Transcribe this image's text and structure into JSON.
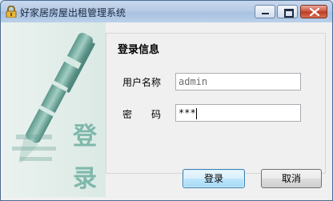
{
  "window": {
    "title": "好家居房屋出租管理系统",
    "app_icon": "lock-icon",
    "controls": {
      "minimize": "minimize-icon",
      "maximize": "maximize-icon",
      "close": "close-icon"
    }
  },
  "banner": {
    "logo_text": "登录",
    "image": "pen-illustration"
  },
  "form": {
    "group_title": "登录信息",
    "username_label": "用户名称",
    "username_value": "admin",
    "password_label": "密　　码",
    "password_value": "***"
  },
  "buttons": {
    "login": "登录",
    "cancel": "取消"
  },
  "colors": {
    "accent_border": "#3c7fb1",
    "banner_teal": "#5e9e92"
  }
}
